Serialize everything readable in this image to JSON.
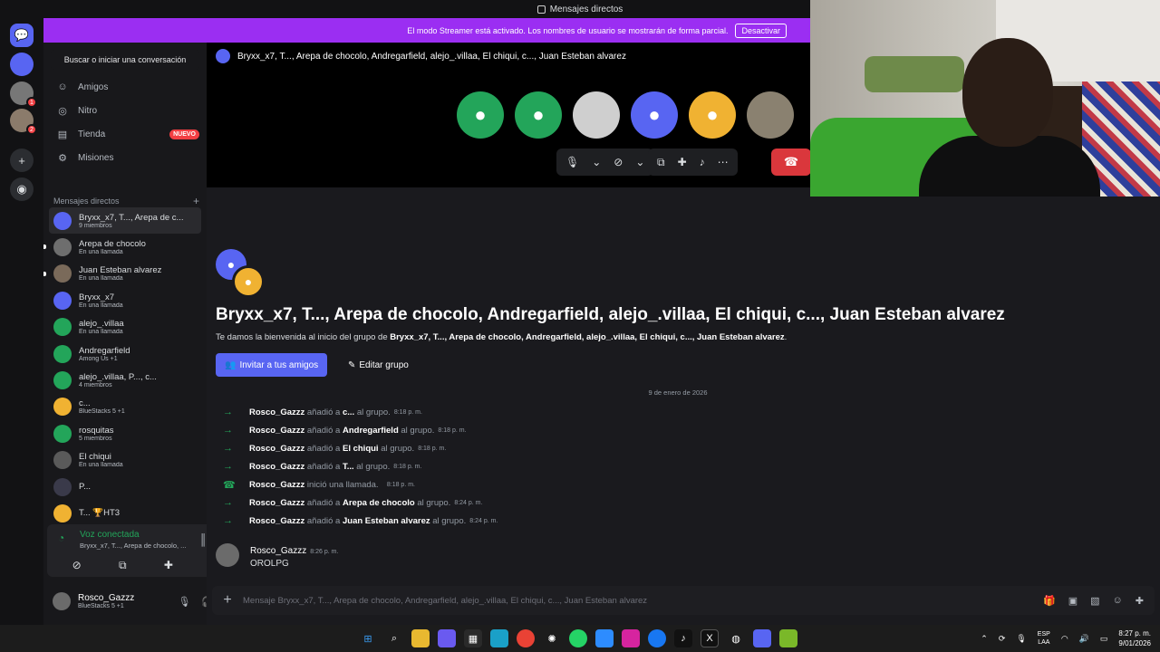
{
  "window": {
    "title": "Mensajes directos"
  },
  "banner": {
    "text": "El modo Streamer está activado. Los nombres de usuario se mostrarán de forma parcial.",
    "button": "Desactivar"
  },
  "servers": [
    {
      "badge": ""
    },
    {
      "badge": "1"
    },
    {
      "badge": "2"
    }
  ],
  "sidebar": {
    "search": "Buscar o iniciar una conversación",
    "nav": [
      {
        "label": "Amigos",
        "icon": "friends-icon"
      },
      {
        "label": "Nitro",
        "icon": "nitro-icon"
      },
      {
        "label": "Tienda",
        "icon": "store-icon",
        "badge": "NUEVO"
      },
      {
        "label": "Misiones",
        "icon": "quests-icon"
      }
    ],
    "dm_header": "Mensajes directos",
    "dms": [
      {
        "name": "Bryxx_x7, T..., Arepa de c...",
        "status": "9 miembros",
        "color": "#5865f2",
        "selected": true
      },
      {
        "name": "Arepa de chocolo",
        "status": "En una llamada",
        "color": "#6e6e6e"
      },
      {
        "name": "Juan Esteban alvarez",
        "status": "En una llamada",
        "color": "#7a6a5a"
      },
      {
        "name": "Bryxx_x7",
        "status": "En una llamada",
        "color": "#5865f2"
      },
      {
        "name": "alejo_.villaa",
        "status": "En una llamada",
        "color": "#23a55a"
      },
      {
        "name": "Andregarfield",
        "status": "Among Us +1",
        "color": "#23a55a"
      },
      {
        "name": "alejo_.villaa, P..., c...",
        "status": "4 miembros",
        "color": "#23a55a"
      },
      {
        "name": "c...",
        "status": "BlueStacks 5 +1",
        "color": "#f0b232"
      },
      {
        "name": "rosquitas",
        "status": "5 miembros",
        "color": "#23a55a"
      },
      {
        "name": "El chiqui",
        "status": "En una llamada",
        "color": "#5a5a5a"
      },
      {
        "name": "P...",
        "status": "",
        "color": "#3a3a4a"
      },
      {
        "name": "T... 🏆HT3",
        "status": "",
        "color": "#f0b232"
      }
    ],
    "voice": {
      "title": "Voz conectada",
      "sub": "Bryxx_x7, T..., Arepa de chocolo, ..."
    },
    "user": {
      "name": "Rosco_Gazzz",
      "status": "BlueStacks 5 +1"
    }
  },
  "channel": {
    "title": "Bryxx_x7, T..., Arepa de chocolo, Andregarfield, alejo_.villaa, El chiqui, c..., Juan Esteban alvarez"
  },
  "call": {
    "participants": [
      {
        "color": "#23a55a"
      },
      {
        "color": "#23a55a"
      },
      {
        "color": "#cfcfcf"
      },
      {
        "color": "#5865f2"
      },
      {
        "color": "#f0b232"
      },
      {
        "color": "#8a8170"
      }
    ]
  },
  "welcome": {
    "title": "Bryxx_x7, T..., Arepa de chocolo, Andregarfield, alejo_.villaa, El chiqui, c..., Juan Esteban alvarez",
    "sub_prefix": "Te damos la bienvenida al inicio del grupo de ",
    "sub_group": "Bryxx_x7, T..., Arepa de chocolo, Andregarfield, alejo_.villaa, El chiqui, c..., Juan Esteban alvarez",
    "sub_suffix": ".",
    "invite": "Invitar a tus amigos",
    "edit": "Editar grupo"
  },
  "date_divider": "9 de enero de 2026",
  "system_messages": [
    {
      "actor": "Rosco_Gazzz",
      "verb": "añadió a",
      "target": "c...",
      "rest": "al grupo.",
      "time": "8:18 p. m.",
      "kind": "add"
    },
    {
      "actor": "Rosco_Gazzz",
      "verb": "añadió a",
      "target": "Andregarfield",
      "rest": "al grupo.",
      "time": "8:18 p. m.",
      "kind": "add"
    },
    {
      "actor": "Rosco_Gazzz",
      "verb": "añadió a",
      "target": "El chiqui",
      "rest": "al grupo.",
      "time": "8:18 p. m.",
      "kind": "add"
    },
    {
      "actor": "Rosco_Gazzz",
      "verb": "añadió a",
      "target": "T...",
      "rest": "al grupo.",
      "time": "8:18 p. m.",
      "kind": "add"
    },
    {
      "actor": "Rosco_Gazzz",
      "verb": "inició una llamada.",
      "target": "",
      "rest": "",
      "time": "8:18 p. m.",
      "kind": "call"
    },
    {
      "actor": "Rosco_Gazzz",
      "verb": "añadió a",
      "target": "Arepa de chocolo",
      "rest": "al grupo.",
      "time": "8:24 p. m.",
      "kind": "add"
    },
    {
      "actor": "Rosco_Gazzz",
      "verb": "añadió a",
      "target": "Juan Esteban alvarez",
      "rest": "al grupo.",
      "time": "8:24 p. m.",
      "kind": "add"
    }
  ],
  "message": {
    "author": "Rosco_Gazzz",
    "time": "8:26 p. m.",
    "text": "OROLPG"
  },
  "composer": {
    "placeholder": "Mensaje Bryxx_x7, T..., Arepa de chocolo, Andregarfield, alejo_.villaa, El chiqui, c..., Juan Esteban alvarez"
  },
  "taskbar": {
    "lang1": "ESP",
    "lang2": "LAA",
    "time": "8:27 p. m.",
    "date": "9/01/2026"
  }
}
